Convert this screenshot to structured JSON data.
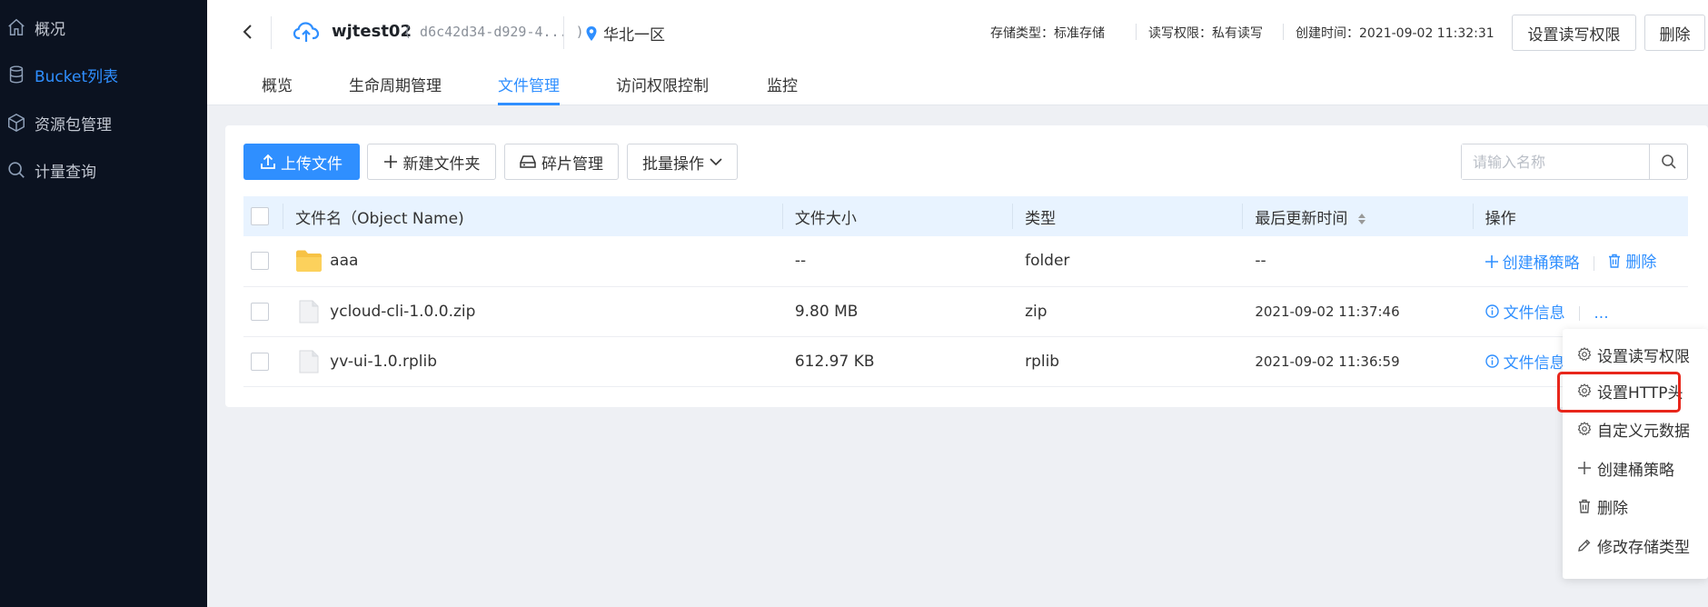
{
  "sidebar": {
    "items": [
      {
        "label": "概况",
        "icon": "home-icon",
        "active": false
      },
      {
        "label": "Bucket列表",
        "icon": "database-icon",
        "active": true
      },
      {
        "label": "资源包管理",
        "icon": "box-icon",
        "active": false
      },
      {
        "label": "计量查询",
        "icon": "search-icon",
        "active": false
      }
    ]
  },
  "header": {
    "bucket_name": "wjtest02",
    "bucket_id": "( d6c42d34-d929-4... )",
    "region": "华北一区",
    "storage_type": "存储类型：标准存储",
    "rw_permission": "读写权限：私有读写",
    "created_time": "创建时间：2021-09-02 11:32:31",
    "set_permission_label": "设置读写权限",
    "delete_label": "删除"
  },
  "tabs": [
    {
      "label": "概览",
      "active": false
    },
    {
      "label": "生命周期管理",
      "active": false
    },
    {
      "label": "文件管理",
      "active": true
    },
    {
      "label": "访问权限控制",
      "active": false
    },
    {
      "label": "监控",
      "active": false
    }
  ],
  "toolbar": {
    "upload_label": "上传文件",
    "new_folder_label": "新建文件夹",
    "fragment_label": "碎片管理",
    "batch_label": "批量操作",
    "search_placeholder": "请输入名称"
  },
  "table": {
    "columns": [
      "文件名（Object Name)",
      "文件大小",
      "类型",
      "最后更新时间",
      "操作"
    ],
    "rows": [
      {
        "name": "aaa",
        "size": "--",
        "type": "folder",
        "updated": "--",
        "kind": "folder",
        "op1": "创建桶策略",
        "op2": "删除"
      },
      {
        "name": "ycloud-cli-1.0.0.zip",
        "size": "9.80 MB",
        "type": "zip",
        "updated": "2021-09-02 11:37:46",
        "kind": "file",
        "op1": "文件信息",
        "op2": "..."
      },
      {
        "name": "yv-ui-1.0.rplib",
        "size": "612.97 KB",
        "type": "rplib",
        "updated": "2021-09-02 11:36:59",
        "kind": "file",
        "op1": "文件信息",
        "op2": ""
      }
    ]
  },
  "dropdown": {
    "items": [
      {
        "label": "设置读写权限",
        "icon": "gear-icon"
      },
      {
        "label": "设置HTTP头",
        "icon": "gear-icon"
      },
      {
        "label": "自定义元数据",
        "icon": "gear-icon"
      },
      {
        "label": "创建桶策略",
        "icon": "plus-icon"
      },
      {
        "label": "删除",
        "icon": "trash-icon"
      },
      {
        "label": "修改存储类型",
        "icon": "pencil-icon"
      }
    ]
  },
  "colors": {
    "accent": "#2f8fff",
    "sidebar_bg": "#0b1220",
    "highlight": "#e8261b",
    "folder": "#f7c244"
  }
}
